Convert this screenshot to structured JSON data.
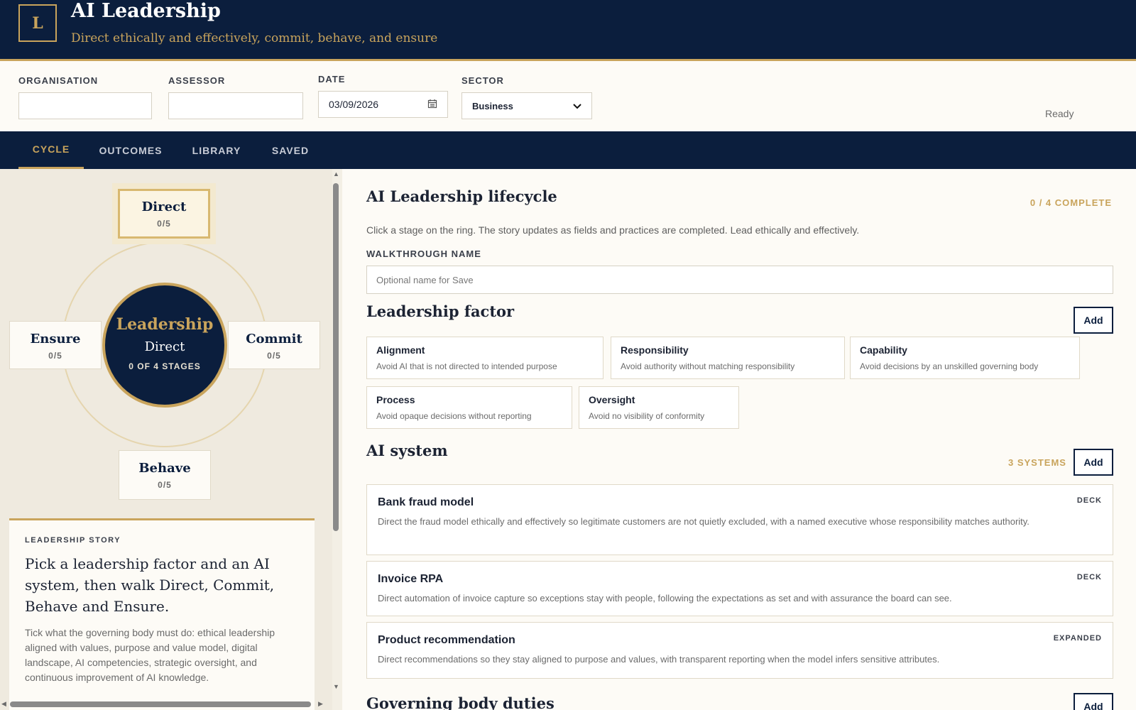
{
  "app": {
    "logo_letter": "L",
    "title": "AI Leadership",
    "subtitle": "Direct ethically and effectively, commit, behave, and ensure"
  },
  "form": {
    "organisation_label": "ORGANISATION",
    "organisation_value": "",
    "assessor_label": "ASSESSOR",
    "assessor_value": "",
    "date_label": "DATE",
    "date_value": "03/09/2026",
    "sector_label": "SECTOR",
    "sector_value": "Business",
    "status": "Ready"
  },
  "tabs": [
    {
      "label": "CYCLE",
      "active": true
    },
    {
      "label": "OUTCOMES",
      "active": false
    },
    {
      "label": "LIBRARY",
      "active": false
    },
    {
      "label": "SAVED",
      "active": false
    }
  ],
  "cycle": {
    "hub_title": "Leadership",
    "hub_stage": "Direct",
    "hub_count": "0 OF 4 STAGES",
    "nodes": [
      {
        "name": "Direct",
        "count": "0/5",
        "selected": true
      },
      {
        "name": "Commit",
        "count": "0/5",
        "selected": false
      },
      {
        "name": "Behave",
        "count": "0/5",
        "selected": false
      },
      {
        "name": "Ensure",
        "count": "0/5",
        "selected": false
      }
    ]
  },
  "story": {
    "label": "LEADERSHIP STORY",
    "headline": "Pick a leadership factor and an AI system, then walk Direct, Commit, Behave and Ensure.",
    "body": "Tick what the governing body must do: ethical leadership aligned with values, purpose and value model, digital landscape, AI competencies, strategic oversight, and continuous improvement of AI knowledge."
  },
  "main": {
    "title": "AI Leadership lifecycle",
    "complete": "0 / 4 COMPLETE",
    "intro": "Click a stage on the ring. The story updates as fields and practices are completed. Lead ethically and effectively.",
    "walkthrough_label": "WALKTHROUGH NAME",
    "walkthrough_placeholder": "Optional name for Save",
    "factor_title": "Leadership factor",
    "add_label": "Add",
    "factors": [
      {
        "name": "Alignment",
        "desc": "Avoid AI that is not directed to intended purpose"
      },
      {
        "name": "Responsibility",
        "desc": "Avoid authority without matching responsibility"
      },
      {
        "name": "Capability",
        "desc": "Avoid decisions by an unskilled governing body"
      },
      {
        "name": "Process",
        "desc": "Avoid opaque decisions without reporting"
      },
      {
        "name": "Oversight",
        "desc": "Avoid no visibility of conformity"
      }
    ],
    "system_title": "AI system",
    "systems_count": "3 SYSTEMS",
    "systems": [
      {
        "name": "Bank fraud model",
        "tag": "DECK",
        "desc": "Direct the fraud model ethically and effectively so legitimate customers are not quietly excluded, with a named executive whose responsibility matches authority."
      },
      {
        "name": "Invoice RPA",
        "tag": "DECK",
        "desc": "Direct automation of invoice capture so exceptions stay with people, following the expectations as set and with assurance the board can see."
      },
      {
        "name": "Product recommendation",
        "tag": "EXPANDED",
        "desc": "Direct recommendations so they stay aligned to purpose and values, with transparent reporting when the model infers sensitive attributes."
      }
    ],
    "duties_title": "Governing body duties"
  }
}
